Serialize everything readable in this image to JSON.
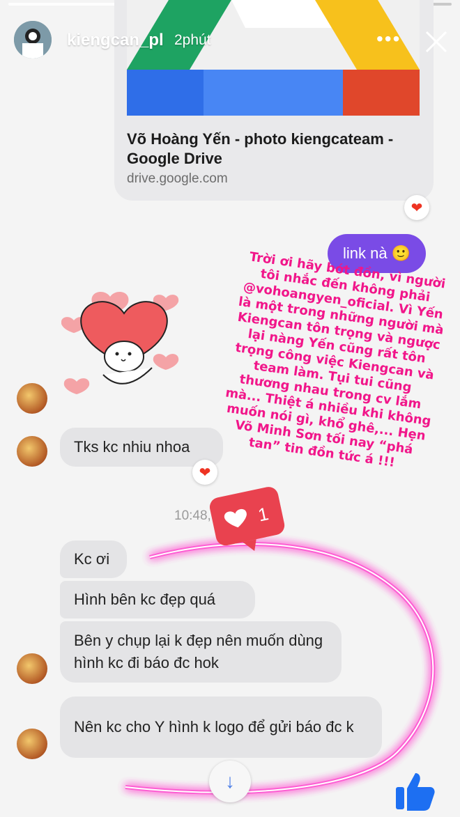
{
  "story": {
    "username": "kiengcan_pl",
    "time": "2phút",
    "more_icon": "more-dots-icon",
    "close_icon": "close-icon"
  },
  "link_card": {
    "title": "Võ Hoàng Yến - photo kiengcateam - Google Drive",
    "domain": "drive.google.com"
  },
  "outgoing": {
    "text": "link nà",
    "emoji": "🙂"
  },
  "overlay_text": "Trời ơi hãy bớt đồn, vì người tôi nhắc đến không phải @vohoangyen_oficial. Vì Yến là một trong những người mà Kiengcan tôn trọng và ngược lại nàng Yến cũng rất tôn trọng công việc Kiengcan  và team làm. Tụi tui cũng thương nhau trong cv lắm mà... Thiệt á nhiều khi không muốn nói gì, khổ ghê,... Hẹn Võ Minh Sơn tối nay “phá tan” tin đồn tức á !!!",
  "messages": [
    {
      "text": "Tks kc nhiu nhoa"
    },
    {
      "text": "Kc ơi"
    },
    {
      "text": "Hình bên kc đẹp quá"
    },
    {
      "text": "Bên y chụp lại k đẹp nên muốn dùng hình kc đi báo đc hok"
    },
    {
      "text": "Nên kc cho Y hình k logo để gửi báo đc k"
    }
  ],
  "timestamp": "10:48, 2",
  "like_count": "1",
  "colors": {
    "accent_purple": "#7a4be6",
    "overlay_pink": "#f1168a",
    "bubble_gray": "#e4e4e6",
    "reaction_red": "#e32222"
  }
}
